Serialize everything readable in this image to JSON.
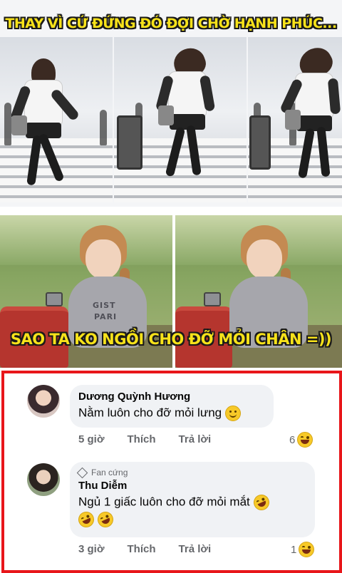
{
  "meme": {
    "top_caption": "THAY VÌ CỨ ĐỨNG ĐÓ ĐỢI CHỜ HẠNH PHÚC...",
    "bottom_caption": "SAO TA KO NGỒI CHO ĐỠ MỎI CHÂN =))",
    "sweater_print_1": "GIST",
    "sweater_print_2": "PARI"
  },
  "comments": [
    {
      "author": "Dương Quỳnh Hương",
      "text": "Nằm luôn cho đỡ mỏi lưng",
      "text_emoji": "slightly-smiling-face",
      "time": "5 giờ",
      "like_label": "Thích",
      "reply_label": "Trả lời",
      "reaction_count": "6",
      "reaction_emoji": "laughing-reaction"
    },
    {
      "badge": "Fan cứng",
      "author": "Thu Diễm",
      "text_line1": "Ngủ 1 giấc luôn cho đỡ mỏi mắt",
      "text_emoji": "rolling-on-floor-laughing",
      "time": "3 giờ",
      "like_label": "Thích",
      "reply_label": "Trả lời",
      "reaction_count": "1",
      "reaction_emoji": "laughing-reaction"
    }
  ],
  "colors": {
    "caption_yellow": "#f7e21a",
    "highlight_border": "#e8161a",
    "bubble_bg": "#f0f2f5",
    "meta_gray": "#65676b"
  }
}
